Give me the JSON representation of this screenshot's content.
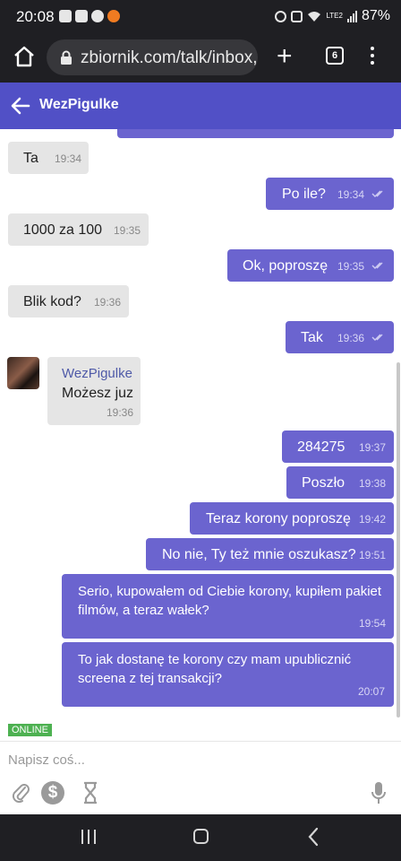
{
  "status": {
    "time": "20:08",
    "battery": "87%",
    "network": "LTE2"
  },
  "browser": {
    "url": "zbiornik.com/talk/inbox,",
    "tab_count": "6"
  },
  "chat": {
    "title": "WezPigulke",
    "status_badge": "ONLINE"
  },
  "messages": [
    {
      "direction": "in",
      "text": "Ta",
      "time": "19:34"
    },
    {
      "direction": "out",
      "text": "Po ile?",
      "time": "19:34",
      "read": true
    },
    {
      "direction": "in",
      "text": "1000 za 100",
      "time": "19:35"
    },
    {
      "direction": "out",
      "text": "Ok, poproszę",
      "time": "19:35",
      "read": true
    },
    {
      "direction": "in",
      "text": "Blik kod?",
      "time": "19:36"
    },
    {
      "direction": "out",
      "text": "Tak",
      "time": "19:36",
      "read": true
    },
    {
      "direction": "in",
      "sender": "WezPigulke",
      "text": "Możesz juz",
      "time": "19:36",
      "avatar": true
    },
    {
      "direction": "out",
      "text": "284275",
      "time": "19:37"
    },
    {
      "direction": "out",
      "text": "Poszło",
      "time": "19:38"
    },
    {
      "direction": "out",
      "text": "Teraz korony poproszę",
      "time": "19:42"
    },
    {
      "direction": "out",
      "text": "No nie, Ty też mnie oszukasz?",
      "time": "19:51"
    },
    {
      "direction": "out",
      "text": "Serio, kupowałem od Ciebie korony, kupiłem pakiet filmów, a teraz wałek?",
      "time": "19:54"
    },
    {
      "direction": "out",
      "text": "To jak dostanę te korony czy mam upublicznić screena z tej transakcji?",
      "time": "20:07"
    }
  ],
  "composer": {
    "placeholder": "Napisz coś..."
  },
  "colors": {
    "accent": "#5150c6",
    "outgoing_bubble": "#6b64cf",
    "incoming_bubble": "#e5e5e5",
    "online": "#4db151"
  }
}
